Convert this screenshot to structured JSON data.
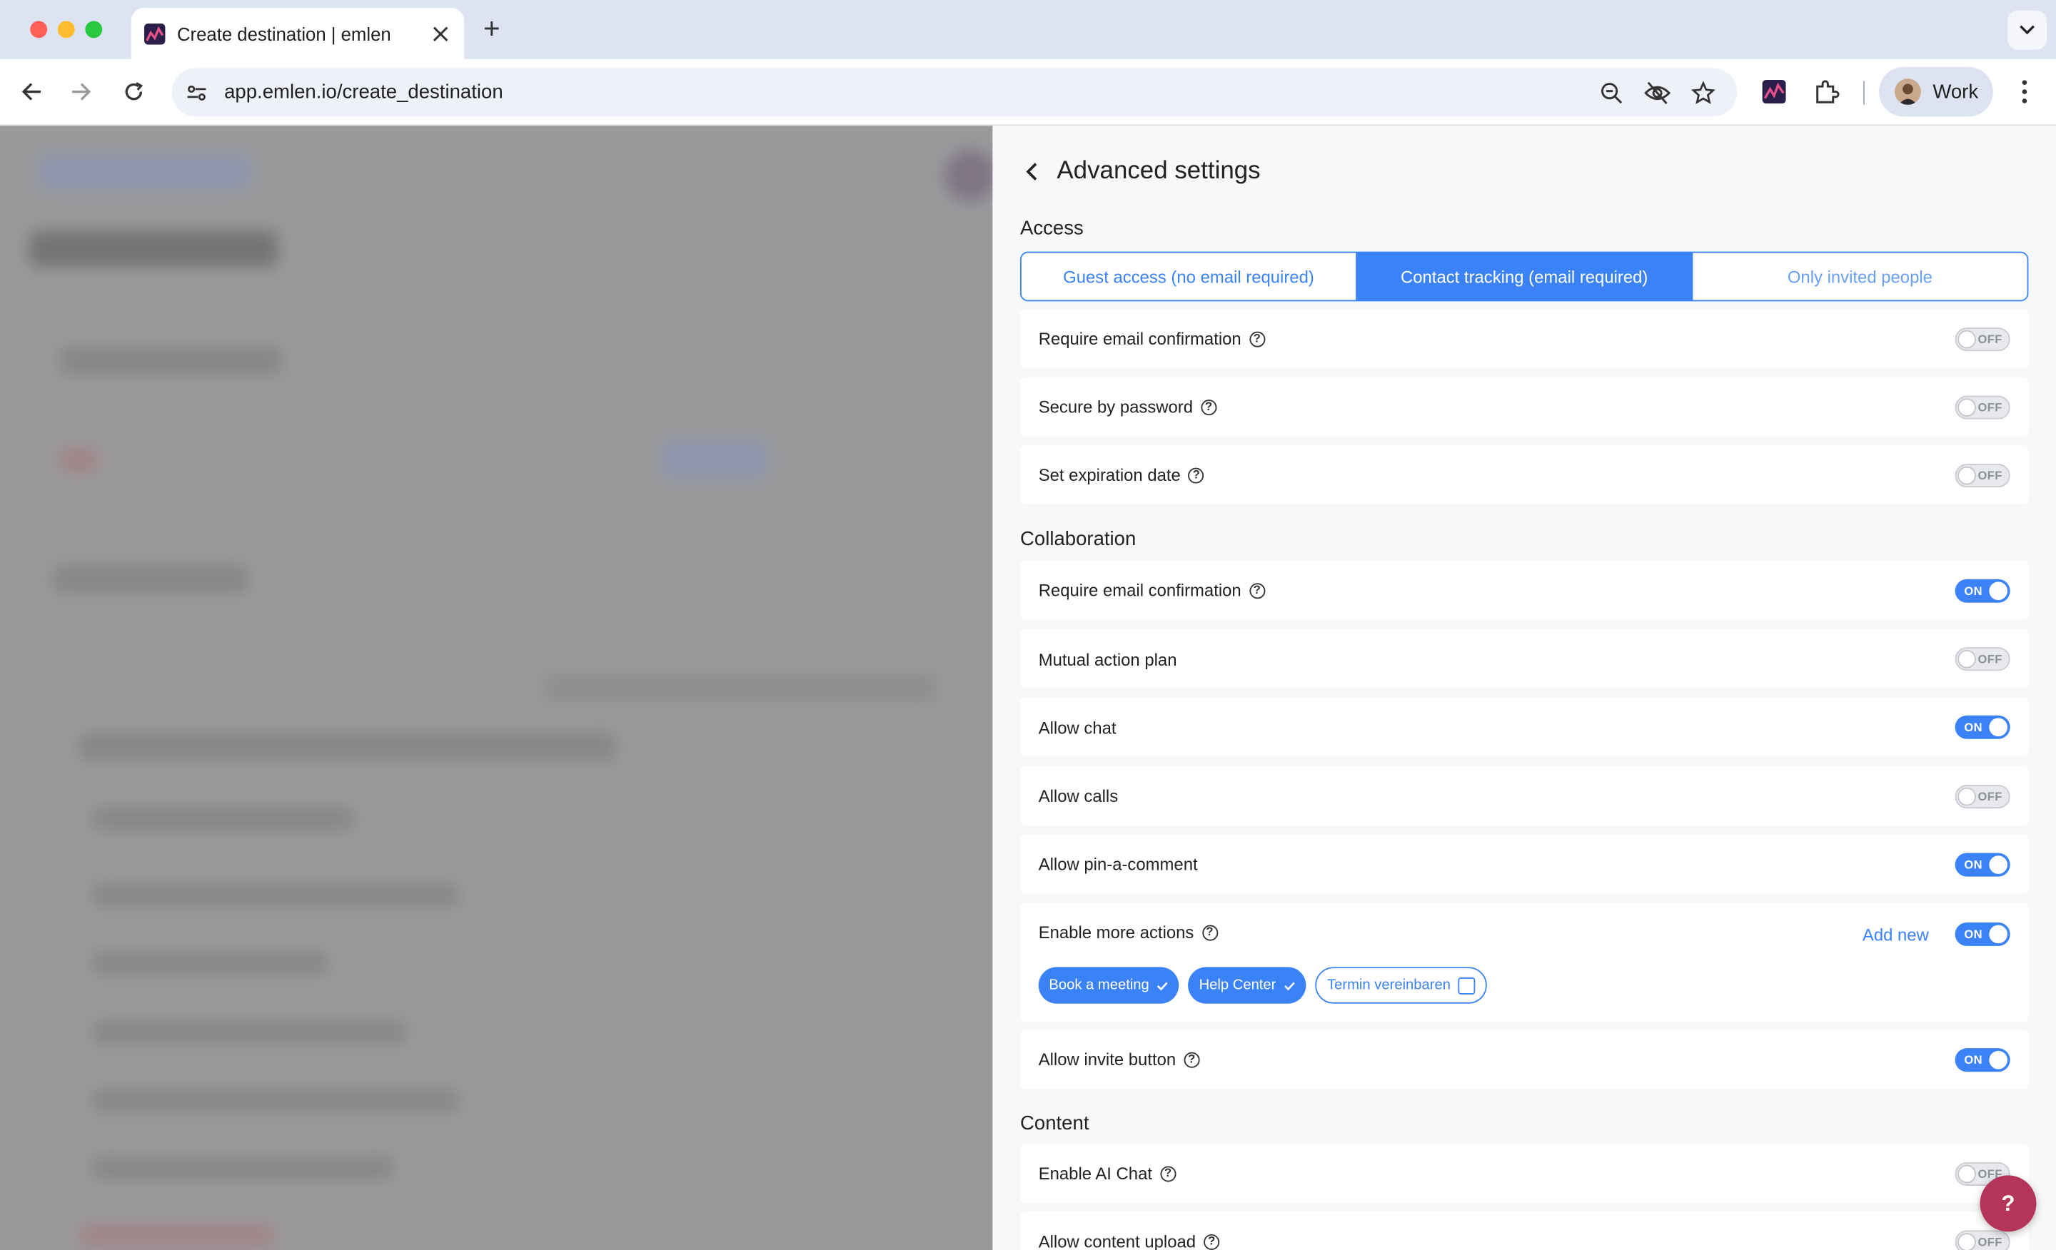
{
  "browser": {
    "tab_title": "Create destination | emlen",
    "new_tab_icon": "+",
    "url": "app.emlen.io/create_destination",
    "profile_name": "Work"
  },
  "panel": {
    "title": "Advanced settings",
    "access": {
      "title": "Access",
      "segments": [
        {
          "label": "Guest access (no email required)",
          "active": false
        },
        {
          "label": "Contact tracking (email required)",
          "active": true
        },
        {
          "label": "Only invited people",
          "active": false
        }
      ],
      "rows": [
        {
          "label": "Require email confirmation",
          "help": true,
          "toggle": "OFF"
        },
        {
          "label": "Secure by password",
          "help": true,
          "toggle": "OFF"
        },
        {
          "label": "Set expiration date",
          "help": true,
          "toggle": "OFF"
        }
      ]
    },
    "collaboration": {
      "title": "Collaboration",
      "rows": [
        {
          "label": "Require email confirmation",
          "help": true,
          "toggle": "ON"
        },
        {
          "label": "Mutual action plan",
          "help": false,
          "toggle": "OFF"
        },
        {
          "label": "Allow chat",
          "help": false,
          "toggle": "ON"
        },
        {
          "label": "Allow calls",
          "help": false,
          "toggle": "OFF"
        },
        {
          "label": "Allow pin-a-comment",
          "help": false,
          "toggle": "ON"
        }
      ],
      "more_actions": {
        "label": "Enable more actions",
        "toggle": "ON",
        "add_new": "Add new",
        "chips": [
          {
            "label": "Book a meeting",
            "selected": true
          },
          {
            "label": "Help Center",
            "selected": true
          },
          {
            "label": "Termin vereinbaren",
            "selected": false
          }
        ]
      },
      "invite": {
        "label": "Allow invite button",
        "toggle": "ON"
      }
    },
    "content": {
      "title": "Content",
      "rows": [
        {
          "label": "Enable AI Chat",
          "help": true,
          "toggle": "OFF"
        },
        {
          "label": "Allow content upload",
          "help": true,
          "toggle": "OFF"
        }
      ]
    }
  },
  "help_fab": "?",
  "colors": {
    "accent": "#3b82f6",
    "help_fab": "#b5345a"
  }
}
